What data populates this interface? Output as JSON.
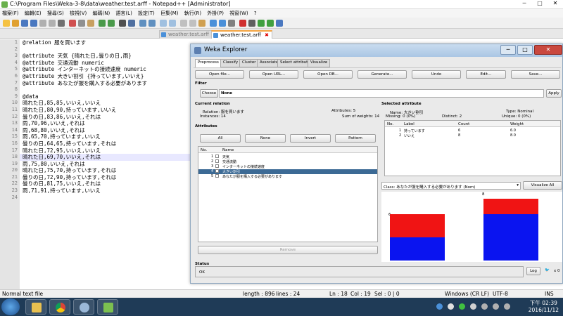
{
  "window": {
    "title": "C:\\Program Files\\Weka-3-8\\data\\weather.test.arff - Notepad++ [Administrator]"
  },
  "menu": [
    "檔案(F)",
    "編輯(E)",
    "搜尋(S)",
    "檢視(V)",
    "編碼(N)",
    "語言(L)",
    "設定(T)",
    "巨集(M)",
    "執行(R)",
    "外掛(P)",
    "視窗(W)",
    "?"
  ],
  "tabs": [
    {
      "label": "weather.test.arff"
    },
    {
      "label": "weather.test.arff"
    }
  ],
  "editor": {
    "line_numbers": [
      "1",
      "2",
      "3",
      "4",
      "5",
      "6",
      "7",
      "8",
      "9",
      "10",
      "11",
      "12",
      "13",
      "14",
      "15",
      "16",
      "17",
      "18",
      "19",
      "20",
      "21",
      "22",
      "23",
      "24"
    ],
    "lines": [
      "@relation 服を買います",
      "",
      "@attribute 天気 {晴れた日,曇りの日,雨}",
      "@attribute 交通流動 numeric",
      "@attribute インターネットの接続速度 numeric",
      "@attribute 大きい割引 {持っています,いいえ}",
      "@attribute あなたが服を購入する必要があります",
      "",
      "@data",
      "晴れた日,85,85,いいえ,いいえ",
      "晴れた日,80,90,持っています,いいえ",
      "曇りの日,83,86,いいえ,それは",
      "雨,70,96,いいえ,それは",
      "雨,68,80,いいえ,それは",
      "雨,65,70,持っています,いいえ",
      "曇りの日,64,65,持っています,それは",
      "晴れた日,72,95,いいえ,いいえ",
      "晴れた日,69,70,いいえ,それは",
      "雨,75,80,いいえ,それは",
      "晴れた日,75,70,持っています,それは",
      "曇りの日,72,90,持っています,それは",
      "曇りの日,81,75,いいえ,それは",
      "雨,71,91,持っています,いいえ",
      ""
    ]
  },
  "status": {
    "type": "Normal text file",
    "length": "length : 896",
    "lines": "lines : 24",
    "ln": "Ln : 18",
    "col": "Col : 19",
    "sel": "Sel : 0 | 0",
    "eol": "Windows (CR LF)",
    "enc": "UTF-8",
    "mode": "INS"
  },
  "clock": {
    "time": "下午 02:39",
    "date": "2016/11/12"
  },
  "weka": {
    "title": "Weka Explorer",
    "tabs": [
      "Preprocess",
      "Classify",
      "Cluster",
      "Associate",
      "Select attributes",
      "Visualize"
    ],
    "buttons": [
      "Open file...",
      "Open URL...",
      "Open DB...",
      "Generate...",
      "Undo",
      "Edit...",
      "Save..."
    ],
    "filter": {
      "label": "Filter",
      "choose": "Choose",
      "value": "None",
      "apply": "Apply"
    },
    "current_relation": {
      "label": "Current relation",
      "relation": "Relation: 服を買います",
      "instances": "Instances: 14",
      "attributes": "Attributes: 5",
      "sum_weights": "Sum of weights: 14"
    },
    "attributes": {
      "label": "Attributes",
      "buttons": [
        "All",
        "None",
        "Invert",
        "Pattern"
      ],
      "col_no": "No.",
      "col_name": "Name",
      "rows": [
        {
          "no": "1",
          "name": "天気"
        },
        {
          "no": "2",
          "name": "交通流動"
        },
        {
          "no": "3",
          "name": "インターネットの接続速度"
        },
        {
          "no": "4",
          "name": "大きい割引"
        },
        {
          "no": "5",
          "name": "あなたが服を購入する必要があります"
        }
      ],
      "remove": "Remove"
    },
    "selected_attribute": {
      "label": "Selected attribute",
      "name": "Name: 大きい割引",
      "type": "Type: Nominal",
      "missing": "Missing: 0 (0%)",
      "distinct": "Distinct: 2",
      "unique": "Unique: 0 (0%)",
      "cols": [
        "No.",
        "Label",
        "Count",
        "Weight"
      ],
      "rows": [
        {
          "no": "1",
          "label": "持っています",
          "count": "6",
          "weight": "6.0"
        },
        {
          "no": "2",
          "label": "いいえ",
          "count": "8",
          "weight": "8.0"
        }
      ]
    },
    "class_select": "Class: あなたが服を購入する必要があります (Nom)",
    "visualize_all": "Visualize All",
    "chart_labels": [
      "6",
      "8"
    ],
    "status": {
      "label": "Status",
      "text": "OK",
      "log": "Log",
      "count": "x 0"
    }
  },
  "chart_data": {
    "type": "bar",
    "categories": [
      "持っています",
      "いいえ"
    ],
    "series": [
      {
        "values": [
          3,
          6
        ]
      },
      {
        "values": [
          3,
          2
        ]
      }
    ],
    "colors": [
      "#0a14f0",
      "#f01414"
    ]
  }
}
